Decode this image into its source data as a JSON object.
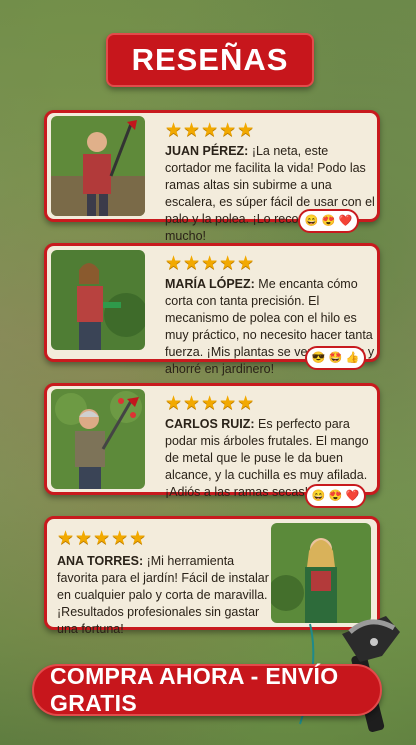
{
  "header": {
    "title": "RESEÑAS"
  },
  "reviews": [
    {
      "stars": "★★★★★",
      "name": "JUAN PÉREZ:",
      "text": " ¡La neta, este cortador me facilita la vida! Podo las ramas altas sin subirme a una escalera, es súper fácil de usar con el palo y la polea. ¡Lo recomiendo mucho!",
      "reactions": [
        "😄",
        "😍",
        "❤️"
      ]
    },
    {
      "stars": "★★★★★",
      "name": "MARÍA LÓPEZ:",
      "text": " Me encanta cómo corta con tanta precisión. El mecanismo de polea con el hilo es muy práctico, no necesito hacer tanta fuerza. ¡Mis plantas se ven geniales y ahorré en jardinero!",
      "reactions": [
        "😎",
        "🤩",
        "👍"
      ]
    },
    {
      "stars": "★★★★★",
      "name": "CARLOS RUIZ:",
      "text": " Es perfecto para podar mis árboles frutales. El mango de metal que le puse le da buen alcance, y la cuchilla es muy afilada. ¡Adiós a las ramas secas!",
      "reactions": [
        "😄",
        "😍",
        "❤️"
      ]
    },
    {
      "stars": "★★★★★",
      "name": "ANA TORRES:",
      "text": " ¡Mi herramienta favorita para el jardín! Fácil de instalar en cualquier palo y corta de maravilla. ¡Resultados profesionales sin gastar una fortuna!"
    }
  ],
  "cta": {
    "label": "COMPRA AHORA - ENVÍO GRATIS"
  },
  "colors": {
    "accent": "#c7161c",
    "card": "#f3ecdc",
    "star": "#f2a900"
  }
}
